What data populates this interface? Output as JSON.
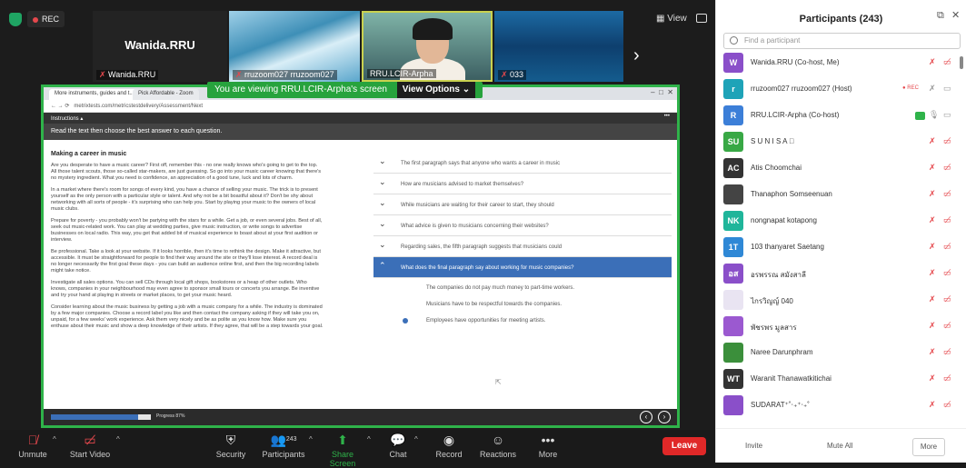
{
  "top": {
    "rec_label": "REC"
  },
  "tiles": [
    {
      "big": "Wanida.RRU",
      "name": "Wanida.RRU"
    },
    {
      "name": "rruzoom027 rruzoom027"
    },
    {
      "name": "RRU.LCIR-Arpha"
    },
    {
      "name": "033"
    }
  ],
  "view_label": "View",
  "share_banner": {
    "text": "You are viewing  RRU.LCIR-Arpha's screen",
    "options": "View Options"
  },
  "browser": {
    "tab1": "More instruments, guides and t...",
    "tab2": "Pick Affordable - Zoom",
    "url": "metrixtests.com/metricstestdelivery/Assessment/Next"
  },
  "exam": {
    "instructions": "Instructions",
    "read_text": "Read the text then choose the best answer to each question.",
    "passage_title": "Making a career in music",
    "paragraphs": [
      "Are you desperate to have a music career? First off, remember this - no one really knows who's going to get to the top. All those talent scouts, those so-called star-makers, are just guessing. So go into your music career knowing that there's no mystery ingredient. What you need is confidence, an appreciation of a good tune, luck and lots of charm.",
      "In a market where there's room for songs of every kind, you have a chance of selling your music. The trick is to present yourself as the only person with a particular style or talent. And why not be a bit boastful about it? Don't be shy about networking with all sorts of people - it's surprising who can help you. Start by playing your music to the owners of local music clubs.",
      "Prepare for poverty - you probably won't be partying with the stars for a while. Get a job, or even several jobs. Best of all, seek out music-related work. You can play at wedding parties, give music instruction, or write songs to advertise businesses on local radio. This way, you get that added bit of musical experience to boast about at your first audition or interview.",
      "Be professional. Take a look at your website. If it looks horrible, then it's time to rethink the design. Make it attractive, but accessible. It must be straightforward for people to find their way around the site or they'll lose interest. A record deal is no longer necessarily the first goal these days - you can build an audience online first, and then the big recording labels might take notice.",
      "Investigate all sales options. You can sell CDs through local gift shops, bookstores or a heap of other outlets. Who knows, companies in your neighbourhood may even agree to sponsor small tours or concerts you arrange. Be inventive and try your hand at playing in streets or market places, to get your music heard.",
      "Consider learning about the music business by getting a job with a music company for a while. The industry is dominated by a few major companies. Choose a record label you like and then contact the company asking if they will take you on, unpaid, for a few weeks' work experience. Ask them very nicely and be as polite as you know how. Make sure you enthuse about their music and show a deep knowledge of their artists. If they agree, that will be a step towards your goal."
    ],
    "questions": [
      "The first paragraph says that anyone who wants a career in music",
      "How are musicians advised to market themselves?",
      "While musicians are waiting for their career to start, they should",
      "What advice is given to musicians concerning their websites?",
      "Regarding sales, the fifth paragraph suggests that musicians could",
      "What does the final paragraph say about working for music companies?"
    ],
    "options": [
      "The companies do not pay much money to part-time workers.",
      "Musicians have to be respectful towards the companies.",
      "Employees have opportunities for meeting artists."
    ],
    "selected_option": 2,
    "progress_label": "Progress 87%",
    "progress": 0.87
  },
  "toolbar": {
    "unmute": "Unmute",
    "start_video": "Start Video",
    "security": "Security",
    "participants": "Participants",
    "participants_count": "243",
    "share": "Share Screen",
    "chat": "Chat",
    "record": "Record",
    "reactions": "Reactions",
    "more": "More",
    "leave": "Leave"
  },
  "panel": {
    "title": "Participants (243)",
    "search_placeholder": "Find a participant",
    "participants": [
      {
        "initial": "W",
        "color": "#8a4fc9",
        "name": "Wanida.RRU (Co-host, Me)",
        "rec": false,
        "share": false
      },
      {
        "initial": "r",
        "color": "#1ea3b8",
        "name": "rruzoom027 rruzoom027 (Host)",
        "rec": true,
        "share": false
      },
      {
        "initial": "R",
        "color": "#3c7fd8",
        "name": "RRU.LCIR-Arpha (Co-host)",
        "rec": false,
        "share": true
      },
      {
        "initial": "SU",
        "color": "#38a845",
        "name": "S U N I S A ⃝",
        "rec": false,
        "share": false
      },
      {
        "initial": "AC",
        "color": "#333333",
        "name": "Atis Choomchai",
        "rec": false,
        "share": false
      },
      {
        "initial": "",
        "color": "#444444",
        "name": "Thanaphon Somseenuan",
        "rec": false,
        "share": false
      },
      {
        "initial": "NK",
        "color": "#1fb59a",
        "name": "nongnapat kotapong",
        "rec": false,
        "share": false
      },
      {
        "initial": "1T",
        "color": "#2f88d6",
        "name": "103 thanyaret Saetang",
        "rec": false,
        "share": false
      },
      {
        "initial": "อส",
        "color": "#8a4fc9",
        "name": "อรพรรณ สมังสาลี",
        "rec": false,
        "share": false
      },
      {
        "initial": "",
        "color": "#e9e4f2",
        "name": "ไกรวิญญ์ 040",
        "rec": false,
        "share": false
      },
      {
        "initial": "",
        "color": "#9b59d0",
        "name": "พัชรพร มูลสาร",
        "rec": false,
        "share": false
      },
      {
        "initial": "",
        "color": "#3b8f3b",
        "name": "Naree Darunphram",
        "rec": false,
        "share": false
      },
      {
        "initial": "WT",
        "color": "#333333",
        "name": "Waranit Thanawatkitichai",
        "rec": false,
        "share": false
      },
      {
        "initial": "",
        "color": "#8a4fc9",
        "name": "SUDARAT⁺˚‧₊⁺‧₊˚",
        "rec": false,
        "share": false
      }
    ],
    "invite": "Invite",
    "mute_all": "Mute All",
    "more": "More"
  }
}
